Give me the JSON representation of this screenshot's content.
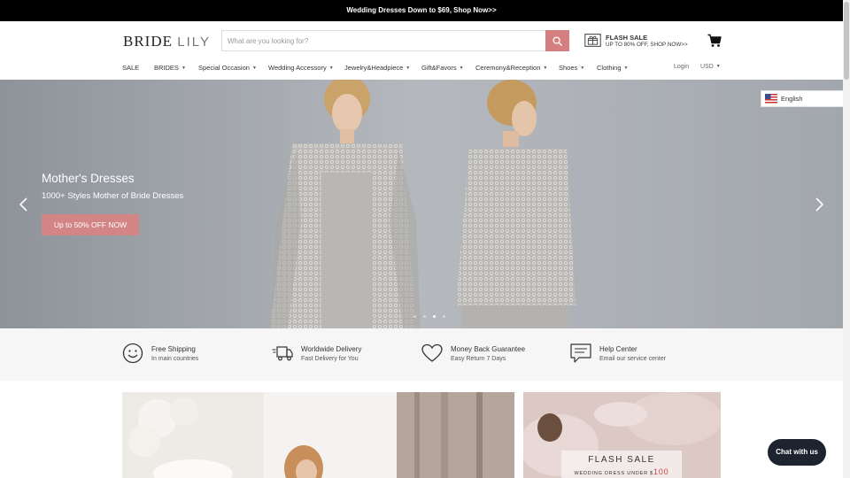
{
  "announcement": {
    "text": "Wedding Dresses Down to $69, Shop Now>>"
  },
  "header": {
    "logo_main": "BRIDE",
    "logo_accent": "LILY",
    "search_placeholder": "What are you looking for?",
    "flash_sale_title": "FLASH SALE",
    "flash_sale_sub": "UP TO 80% OFF, SHOP NOW>>"
  },
  "nav": {
    "items": [
      {
        "label": "SALE",
        "dropdown": false
      },
      {
        "label": "BRIDES",
        "dropdown": true
      },
      {
        "label": "Special Occasion",
        "dropdown": true
      },
      {
        "label": "Wedding Accessory",
        "dropdown": true
      },
      {
        "label": "Jewelry&Headpiece",
        "dropdown": true
      },
      {
        "label": "Gift&Favors",
        "dropdown": true
      },
      {
        "label": "Ceremony&Reception",
        "dropdown": true
      },
      {
        "label": "Shoes",
        "dropdown": true
      },
      {
        "label": "Clothing",
        "dropdown": true
      }
    ],
    "login": "Login",
    "currency": "USD"
  },
  "hero": {
    "title": "Mother's Dresses",
    "subtitle": "1000+ Styles Mother of Bride Dresses",
    "button": "Up to 50% OFF NOW",
    "slide_count": 4,
    "active_slide": 3
  },
  "language": {
    "label": "English"
  },
  "features": [
    {
      "icon": "smiley-icon",
      "title": "Free Shipping",
      "sub": "In main countries"
    },
    {
      "icon": "truck-icon",
      "title": "Worldwide Delivery",
      "sub": "Fast Delivery for You"
    },
    {
      "icon": "heart-icon",
      "title": "Money Back Guarantee",
      "sub": "Easy Return 7 Days"
    },
    {
      "icon": "chat-bubble-icon",
      "title": "Help Center",
      "sub": "Email our service center"
    }
  ],
  "banners": {
    "flash_title": "FLASH SALE",
    "flash_sub": "WEDDING DRESS UNDER $",
    "flash_price": "100"
  },
  "chat": {
    "label": "Chat with us"
  },
  "colors": {
    "accent": "#d57f80",
    "hero_button": "#d38586",
    "chat_bg": "#1d2430",
    "announce_bg": "#000000"
  }
}
